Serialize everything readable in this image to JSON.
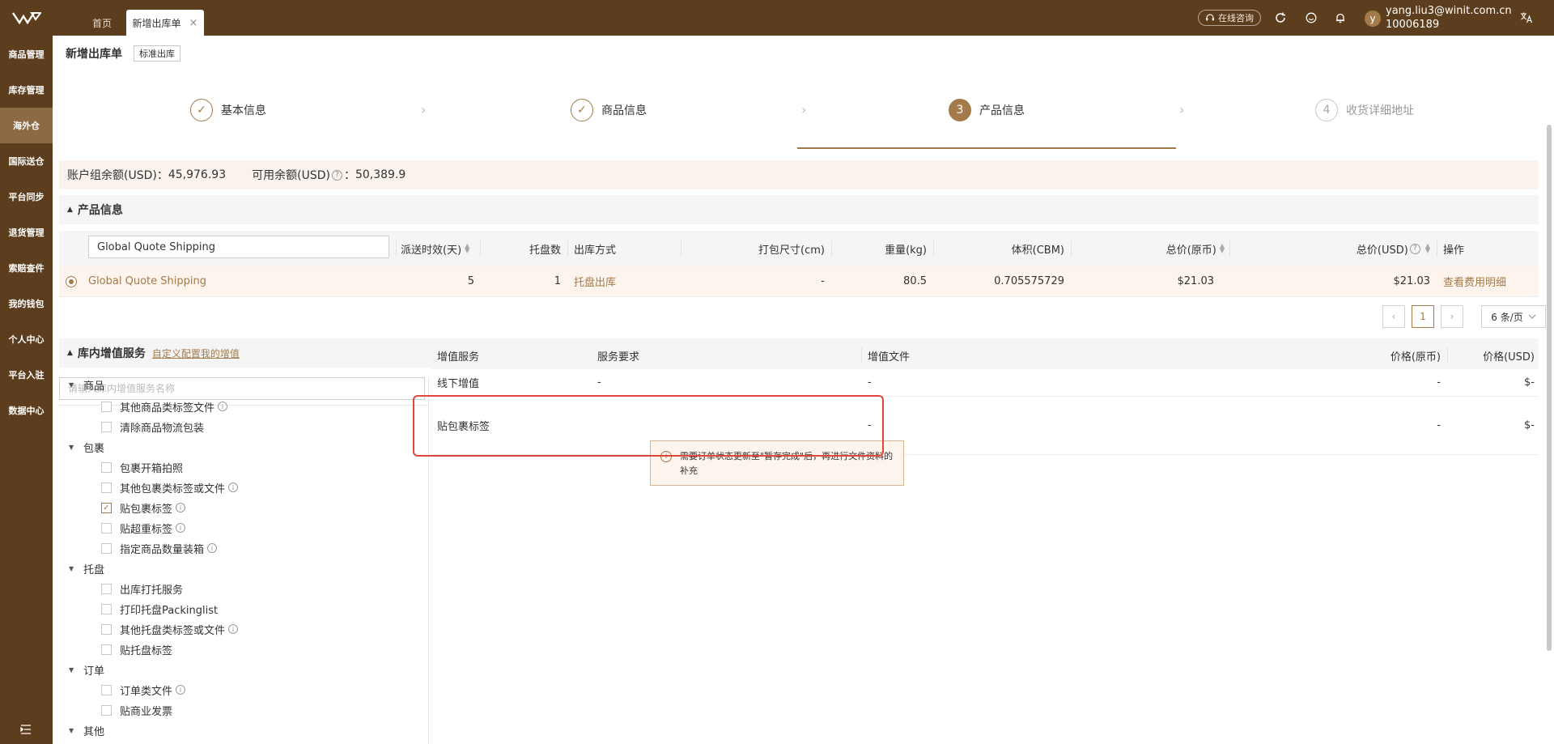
{
  "topbar": {
    "tabs": [
      {
        "label": "首页"
      },
      {
        "label": "新增出库单"
      }
    ],
    "close_glyph": "×",
    "consult_label": "在线咨询",
    "user": {
      "avatar_letter": "y",
      "email": "yang.liu3@winit.com.cn",
      "id": "10006189"
    }
  },
  "sidebar": {
    "items": [
      {
        "label": "商品管理"
      },
      {
        "label": "库存管理"
      },
      {
        "label": "海外仓",
        "active": true
      },
      {
        "label": "国际送仓"
      },
      {
        "label": "平台同步"
      },
      {
        "label": "退货管理"
      },
      {
        "label": "索赔查件"
      },
      {
        "label": "我的钱包"
      },
      {
        "label": "个人中心"
      },
      {
        "label": "平台入驻"
      },
      {
        "label": "数据中心"
      }
    ]
  },
  "page": {
    "title": "新增出库单",
    "badge": "标准出库"
  },
  "steps": [
    {
      "label": "基本信息",
      "state": "done",
      "num": "✓"
    },
    {
      "label": "商品信息",
      "state": "done",
      "num": "✓"
    },
    {
      "label": "产品信息",
      "state": "current",
      "num": "3"
    },
    {
      "label": "收货详细地址",
      "state": "pending",
      "num": "4"
    }
  ],
  "balance": {
    "group_label": "账户组余额(USD)：",
    "group_value": "45,976.93",
    "avail_label": "可用余额(USD)",
    "avail_sep": "：",
    "avail_value": "50,389.9"
  },
  "product_section": {
    "title": "产品信息",
    "name_input": "Global Quote Shipping",
    "headers": {
      "days": "派送时效(天)",
      "pallets": "托盘数",
      "method": "出库方式",
      "size": "打包尺寸(cm)",
      "weight": "重量(kg)",
      "volume": "体积(CBM)",
      "total_orig": "总价(原币)",
      "total_usd": "总价(USD)",
      "op": "操作"
    },
    "row": {
      "name": "Global Quote Shipping",
      "days": "5",
      "pallets": "1",
      "method": "托盘出库",
      "size": "-",
      "weight": "80.5",
      "volume": "0.705575729",
      "total_orig": "$21.03",
      "total_usd": "$21.03",
      "op": "查看费用明细"
    },
    "pagination": {
      "current": "1",
      "page_size": "6 条/页"
    }
  },
  "vas_section": {
    "title": "库内增值服务",
    "config_link": "自定义配置我的增值",
    "search_placeholder": "请输入库内增值服务名称",
    "tree": [
      {
        "group": "商品",
        "items": [
          {
            "label": "其他商品类标签文件",
            "info": true
          },
          {
            "label": "清除商品物流包装"
          }
        ]
      },
      {
        "group": "包裹",
        "items": [
          {
            "label": "包裹开箱拍照"
          },
          {
            "label": "其他包裹类标签或文件",
            "info": true
          },
          {
            "label": "贴包裹标签",
            "info": true,
            "checked": true
          },
          {
            "label": "贴超重标签",
            "info": true
          },
          {
            "label": "指定商品数量装箱",
            "info": true
          }
        ]
      },
      {
        "group": "托盘",
        "items": [
          {
            "label": "出库打托服务"
          },
          {
            "label": "打印托盘Packinglist"
          },
          {
            "label": "其他托盘类标签或文件",
            "info": true
          },
          {
            "label": "贴托盘标签"
          }
        ]
      },
      {
        "group": "订单",
        "items": [
          {
            "label": "订单类文件",
            "info": true
          },
          {
            "label": "贴商业发票"
          }
        ]
      },
      {
        "group": "其他",
        "items": []
      }
    ],
    "table": {
      "headers": {
        "service": "增值服务",
        "req": "服务要求",
        "file": "增值文件",
        "price_orig": "价格(原币)",
        "price_usd": "价格(USD)"
      },
      "rows": [
        {
          "service": "线下增值",
          "req": "-",
          "file": "-",
          "price_orig": "-",
          "price_usd": "$-"
        },
        {
          "service": "贴包裹标签",
          "req": "",
          "file": "-",
          "price_orig": "-",
          "price_usd": "$-"
        }
      ],
      "warning": "需要订单状态更新至\"暂存完成\"后，再进行文件资料的补充"
    }
  },
  "colors": {
    "brand": "#5c3d1e",
    "accent": "#a37a4a",
    "highlight": "#e0463b"
  }
}
